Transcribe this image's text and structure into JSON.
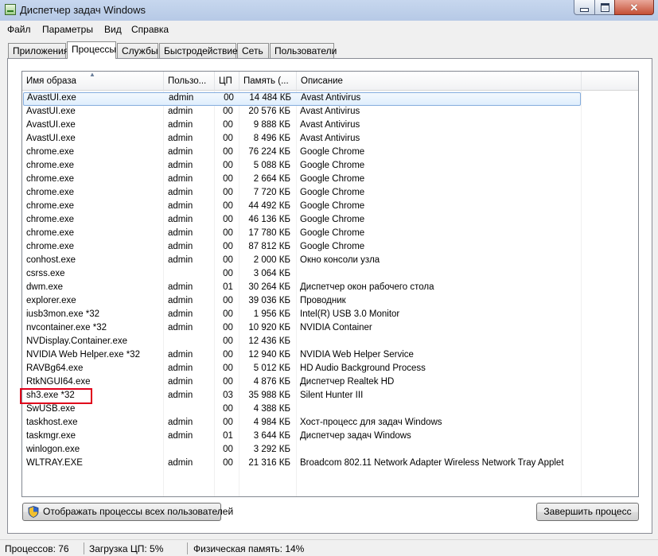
{
  "window": {
    "title": "Диспетчер задач Windows"
  },
  "menu": [
    "Файл",
    "Параметры",
    "Вид",
    "Справка"
  ],
  "tabs": [
    "Приложения",
    "Процессы",
    "Службы",
    "Быстродействие",
    "Сеть",
    "Пользователи"
  ],
  "active_tab": "Процессы",
  "columns": [
    "Имя образа",
    "Пользо...",
    "ЦП",
    "Память (...",
    "Описание"
  ],
  "processes": [
    {
      "name": "AvastUI.exe",
      "user": "admin",
      "cpu": "00",
      "mem": "14 484 КБ",
      "desc": "Avast Antivirus"
    },
    {
      "name": "AvastUI.exe",
      "user": "admin",
      "cpu": "00",
      "mem": "20 576 КБ",
      "desc": "Avast Antivirus"
    },
    {
      "name": "AvastUI.exe",
      "user": "admin",
      "cpu": "00",
      "mem": "9 888 КБ",
      "desc": "Avast Antivirus"
    },
    {
      "name": "AvastUI.exe",
      "user": "admin",
      "cpu": "00",
      "mem": "8 496 КБ",
      "desc": "Avast Antivirus"
    },
    {
      "name": "chrome.exe",
      "user": "admin",
      "cpu": "00",
      "mem": "76 224 КБ",
      "desc": "Google Chrome"
    },
    {
      "name": "chrome.exe",
      "user": "admin",
      "cpu": "00",
      "mem": "5 088 КБ",
      "desc": "Google Chrome"
    },
    {
      "name": "chrome.exe",
      "user": "admin",
      "cpu": "00",
      "mem": "2 664 КБ",
      "desc": "Google Chrome"
    },
    {
      "name": "chrome.exe",
      "user": "admin",
      "cpu": "00",
      "mem": "7 720 КБ",
      "desc": "Google Chrome"
    },
    {
      "name": "chrome.exe",
      "user": "admin",
      "cpu": "00",
      "mem": "44 492 КБ",
      "desc": "Google Chrome"
    },
    {
      "name": "chrome.exe",
      "user": "admin",
      "cpu": "00",
      "mem": "46 136 КБ",
      "desc": "Google Chrome"
    },
    {
      "name": "chrome.exe",
      "user": "admin",
      "cpu": "00",
      "mem": "17 780 КБ",
      "desc": "Google Chrome"
    },
    {
      "name": "chrome.exe",
      "user": "admin",
      "cpu": "00",
      "mem": "87 812 КБ",
      "desc": "Google Chrome"
    },
    {
      "name": "conhost.exe",
      "user": "admin",
      "cpu": "00",
      "mem": "2 000 КБ",
      "desc": "Окно консоли узла"
    },
    {
      "name": "csrss.exe",
      "user": "",
      "cpu": "00",
      "mem": "3 064 КБ",
      "desc": ""
    },
    {
      "name": "dwm.exe",
      "user": "admin",
      "cpu": "01",
      "mem": "30 264 КБ",
      "desc": "Диспетчер окон рабочего стола"
    },
    {
      "name": "explorer.exe",
      "user": "admin",
      "cpu": "00",
      "mem": "39 036 КБ",
      "desc": "Проводник"
    },
    {
      "name": "iusb3mon.exe *32",
      "user": "admin",
      "cpu": "00",
      "mem": "1 956 КБ",
      "desc": "Intel(R) USB 3.0 Monitor"
    },
    {
      "name": "nvcontainer.exe *32",
      "user": "admin",
      "cpu": "00",
      "mem": "10 920 КБ",
      "desc": "NVIDIA Container"
    },
    {
      "name": "NVDisplay.Container.exe",
      "user": "",
      "cpu": "00",
      "mem": "12 436 КБ",
      "desc": ""
    },
    {
      "name": "NVIDIA Web Helper.exe *32",
      "user": "admin",
      "cpu": "00",
      "mem": "12 940 КБ",
      "desc": "NVIDIA Web Helper Service"
    },
    {
      "name": "RAVBg64.exe",
      "user": "admin",
      "cpu": "00",
      "mem": "5 012 КБ",
      "desc": "HD Audio Background Process"
    },
    {
      "name": "RtkNGUI64.exe",
      "user": "admin",
      "cpu": "00",
      "mem": "4 876 КБ",
      "desc": "Диспетчер Realtek HD"
    },
    {
      "name": "sh3.exe *32",
      "user": "admin",
      "cpu": "03",
      "mem": "35 988 КБ",
      "desc": "Silent Hunter III"
    },
    {
      "name": "SwUSB.exe",
      "user": "",
      "cpu": "00",
      "mem": "4 388 КБ",
      "desc": ""
    },
    {
      "name": "taskhost.exe",
      "user": "admin",
      "cpu": "00",
      "mem": "4 984 КБ",
      "desc": "Хост-процесс для задач Windows"
    },
    {
      "name": "taskmgr.exe",
      "user": "admin",
      "cpu": "01",
      "mem": "3 644 КБ",
      "desc": "Диспетчер задач Windows"
    },
    {
      "name": "winlogon.exe",
      "user": "",
      "cpu": "00",
      "mem": "3 292 КБ",
      "desc": ""
    },
    {
      "name": "WLTRAY.EXE",
      "user": "admin",
      "cpu": "00",
      "mem": "21 316 КБ",
      "desc": "Broadcom 802.11 Network Adapter Wireless Network Tray Applet"
    }
  ],
  "buttons": {
    "show_all": "Отображать процессы всех пользователей",
    "end_process": "Завершить процесс"
  },
  "status": {
    "processes": "Процессов: 76",
    "cpu": "Загрузка ЦП: 5%",
    "memory": "Физическая память: 14%"
  },
  "colors": {
    "highlight_box": "#e0001b",
    "selection": "#dfeefd"
  },
  "icons": [
    "app-icon",
    "minimize-icon",
    "maximize-icon",
    "close-icon",
    "shield-icon",
    "sort-ascending-icon"
  ]
}
